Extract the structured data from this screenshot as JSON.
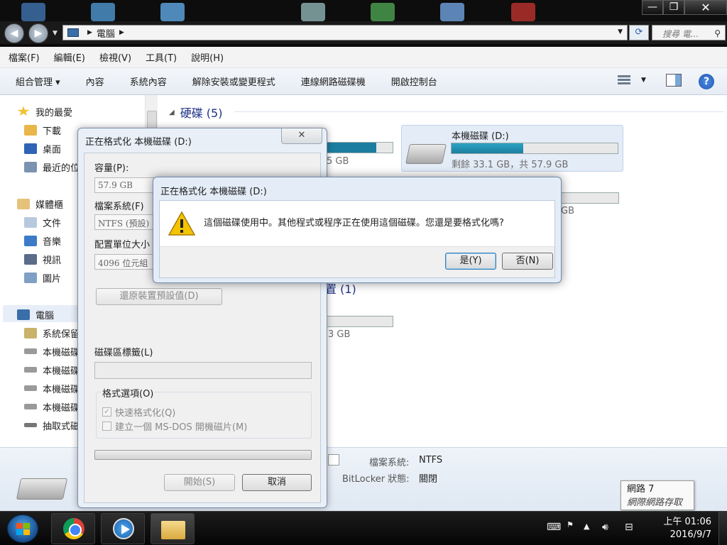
{
  "window": {
    "breadcrumb": "電腦",
    "search_placeholder": "搜尋 電...",
    "controls": {
      "minimize": "—",
      "restore": "❐",
      "close": "✕"
    }
  },
  "menubar": [
    "檔案(F)",
    "編輯(E)",
    "檢視(V)",
    "工具(T)",
    "說明(H)"
  ],
  "commandbar": {
    "organize": "組合管理 ▾",
    "items": [
      "內容",
      "系統內容",
      "解除安裝或變更程式",
      "連線網路磁碟機",
      "開啟控制台"
    ]
  },
  "nav": {
    "favorites": "我的最愛",
    "downloads": "下載",
    "desktop": "桌面",
    "recent": "最近的位",
    "libraries": "媒體櫃",
    "documents": "文件",
    "music": "音樂",
    "videos": "視訊",
    "pictures": "圖片",
    "computer": "電腦",
    "system_drive": "系統保留",
    "local1": "本機磁碟",
    "local2": "本機磁碟",
    "local3": "本機磁碟",
    "local4": "本機磁碟",
    "removable": "抽取式磁"
  },
  "content": {
    "group_header": "硬碟 (5)",
    "group2_header": "置 (1)",
    "drive_d": {
      "name": "本機磁碟 (D:)",
      "free": "剩餘 33.1 GB，共 57.9 GB",
      "used_fraction": 0.43
    },
    "bg_text_1": "5 GB",
    "bg_text_2": "GB",
    "bg_text_3": "3 GB"
  },
  "details": {
    "fs_label": "檔案系統:",
    "fs_value": "NTFS",
    "bitlocker_label": "BitLocker 狀態:",
    "bitlocker_value": "關閉"
  },
  "tooltip": {
    "line1": "網路  7",
    "line2": "網際網路存取"
  },
  "format_dialog": {
    "title": "正在格式化 本機磁碟 (D:)",
    "capacity_label": "容量(P):",
    "capacity_value": "57.9 GB",
    "filesystem_label": "檔案系統(F)",
    "filesystem_value": "NTFS (預設)",
    "alloc_label": "配置單位大小",
    "alloc_value": "4096 位元組",
    "restore_defaults": "還原裝置預設值(D)",
    "volume_label": "磁碟區標籤(L)",
    "options_legend": "格式選項(O)",
    "quick_format": "快速格式化(Q)",
    "msdos_disk": "建立一個 MS-DOS 開機磁片(M)",
    "start": "開始(S)",
    "cancel": "取消"
  },
  "confirm_dialog": {
    "title": "正在格式化 本機磁碟 (D:)",
    "message": "這個磁碟使用中。其他程式或程序正在使用這個磁碟。您還是要格式化嗎?",
    "yes": "是(Y)",
    "no": "否(N)"
  },
  "taskbar": {
    "time": "上午 01:06",
    "date": "2016/9/7"
  },
  "colors": {
    "accent": "#1e3287",
    "drive_bar": "#1b7ea0",
    "warning": "#f5c400"
  }
}
